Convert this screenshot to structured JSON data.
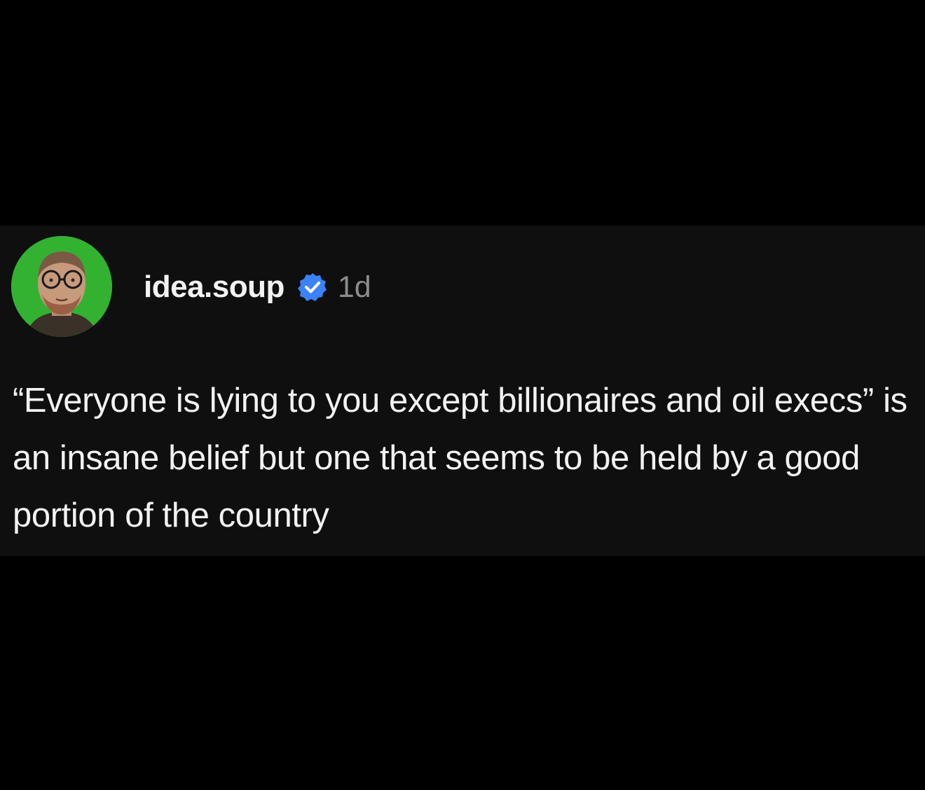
{
  "post": {
    "username": "idea.soup",
    "verified_icon": "verified-badge-icon",
    "verified_color": "#3b82f6",
    "timestamp": "1d",
    "text": "“Everyone is lying to you except billionaires and oil execs” is an insane belief but one that seems to be held by a good portion of the country"
  },
  "colors": {
    "page_background": "#000000",
    "card_background": "#0f0f0f",
    "avatar_ring": "#33b232",
    "primary_text": "#f2f2f2",
    "secondary_text": "#8c8c8c"
  }
}
